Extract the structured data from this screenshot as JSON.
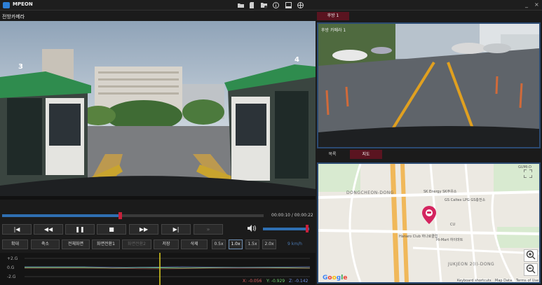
{
  "app": {
    "title": "MPEON"
  },
  "titlebar": {
    "icons": [
      "folder-open-icon",
      "sd-card-icon",
      "folder-settings-icon",
      "info-icon",
      "window-icon",
      "globe-icon"
    ],
    "minimize": "_",
    "close": "×"
  },
  "front": {
    "label": "전방카메라",
    "booth_left_number": "3",
    "booth_right_number": "4"
  },
  "playback": {
    "time": "00:00:10 / 00:00:22",
    "progress": 0.45,
    "volume": 0.95
  },
  "controls": {
    "first": "|◀",
    "rewind": "◀◀",
    "pause": "❚❚",
    "stop": "■",
    "forward": "▶▶",
    "last": "▶|",
    "fast": "»",
    "volume": "🔊"
  },
  "actions": {
    "zoom_in": "확대",
    "zoom_out": "축소",
    "fullscreen": "전체화면",
    "screen1": "화면전환1",
    "screen2": "화면전환2",
    "save": "저장",
    "delete": "삭제"
  },
  "speeds": [
    "0.5x",
    "1.0x",
    "1.5x",
    "2.0x"
  ],
  "speed_selected": "1.0x",
  "speed_kmh": "9 km/h",
  "gsensor": {
    "labels": [
      "+2.G",
      "0.G",
      "-2.G"
    ],
    "x": "X: -0.056",
    "y": "Y: -0.929",
    "z": "Z: -0.142",
    "colors": {
      "x": "#e06060",
      "y": "#6fcf6f",
      "z": "#6f8fe0"
    }
  },
  "rear": {
    "tab": "후방 1",
    "label": "후방 카메라 1"
  },
  "tabs": {
    "list": "목록",
    "map": "지도"
  },
  "map": {
    "labels": {
      "dongcheon": "DONGCHEON-DONG",
      "jukjeon": "JUKJEON 2(I)-DONG",
      "gumi": "GUMI-D",
      "sk": "SK Energy SK주유소",
      "gs": "GS Caltex LPG GS충전소",
      "hanaro": "Hanaro Club 하나로클럽",
      "himart": "Hi-Mart 하이마트",
      "cu": "CU"
    },
    "footer": {
      "shortcuts": "Keyboard shortcuts",
      "mapdata": "Map Data",
      "terms": "Terms of Use"
    },
    "google": "Google"
  }
}
